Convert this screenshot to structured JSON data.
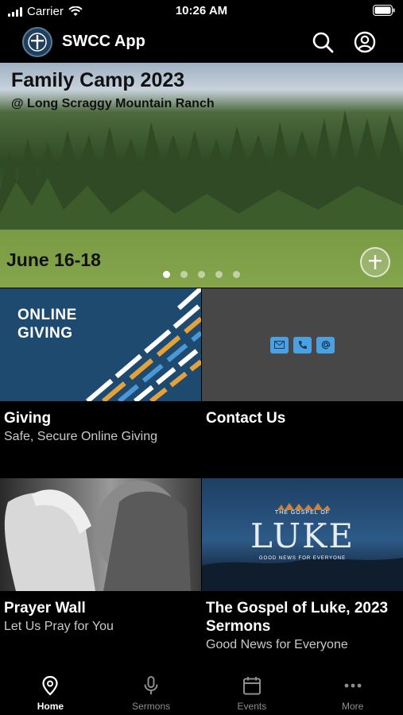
{
  "status_bar": {
    "carrier": "Carrier",
    "time": "10:26 AM"
  },
  "header": {
    "title": "SWCC App"
  },
  "hero": {
    "title": "Family Camp 2023",
    "subtitle": "@ Long Scraggy Mountain Ranch",
    "date": "June 16-18",
    "page_count": 5,
    "active_page": 1
  },
  "tiles": [
    {
      "image_text": "ONLINE\nGIVING",
      "title": "Giving",
      "subtitle": "Safe, Secure Online Giving"
    },
    {
      "title": "Contact Us",
      "icons": [
        "mail-icon",
        "phone-icon",
        "at-icon"
      ]
    },
    {
      "title": "Prayer Wall",
      "subtitle": "Let Us Pray for You"
    },
    {
      "image_small": "THE GOSPEL OF",
      "image_big": "LUKE",
      "image_tag": "GOOD NEWS FOR EVERYONE",
      "title": "The Gospel of Luke, 2023 Sermons",
      "subtitle": "Good News for Everyone"
    }
  ],
  "tab_bar": {
    "items": [
      {
        "label": "Home",
        "icon": "location-pin-icon",
        "active": true
      },
      {
        "label": "Sermons",
        "icon": "microphone-icon",
        "active": false
      },
      {
        "label": "Events",
        "icon": "calendar-icon",
        "active": false
      },
      {
        "label": "More",
        "icon": "more-dots-icon",
        "active": false
      }
    ]
  }
}
